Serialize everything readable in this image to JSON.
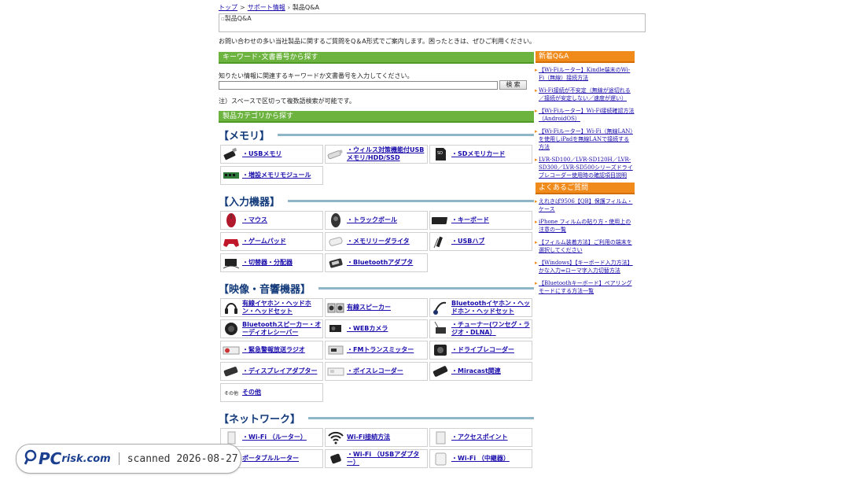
{
  "breadcrumb": {
    "home": "トップ",
    "support": "サポート情報",
    "current": "製品Q&A",
    "sep": ">"
  },
  "banner_alt": "製品Q&A",
  "intro": "お問い合わせの多い当社製品に関するご質問をQ＆A形式でご案内します。困ったときは、ぜひご利用ください。",
  "keyword": {
    "heading": "キーワード･文書番号から探す",
    "desc": "知りたい情報に関連するキーワードか文書番号を入力してください。",
    "input_value": "",
    "button": "検 索",
    "note": "注）スペースで区切って複数語検索が可能です。"
  },
  "category_heading": "製品カテゴリから探す",
  "categories": [
    {
      "title": "【メモリ】",
      "items": [
        {
          "label": "・USBメモリ",
          "icon": "usb-stick-icon"
        },
        {
          "label": "・ウィルス対策機能付USBメモリ/HDD/SSD",
          "icon": "security-usb-icon"
        },
        {
          "label": "・SDメモリカード",
          "icon": "sd-card-icon"
        },
        {
          "label": "・増設メモリモジュール",
          "icon": "memory-module-icon"
        }
      ]
    },
    {
      "title": "【入力機器】",
      "items": [
        {
          "label": "・マウス",
          "icon": "mouse-icon"
        },
        {
          "label": "・トラックボール",
          "icon": "trackball-icon"
        },
        {
          "label": "・キーボード",
          "icon": "keyboard-icon"
        },
        {
          "label": "・ゲームパッド",
          "icon": "gamepad-icon"
        },
        {
          "label": "・メモリリーダライタ",
          "icon": "card-reader-icon"
        },
        {
          "label": "・USBハブ",
          "icon": "usb-hub-icon"
        },
        {
          "label": "・切替器・分配器",
          "icon": "switcher-icon"
        },
        {
          "label": "・Bluetoothアダプタ",
          "icon": "bluetooth-adapter-icon"
        }
      ]
    },
    {
      "title": "【映像・音響機器】",
      "items": [
        {
          "label": "有線イヤホン・ヘッドホン・ヘッドセット",
          "icon": "headphones-icon"
        },
        {
          "label": "有線スピーカー",
          "icon": "speaker-icon"
        },
        {
          "label": "Bluetoothイヤホン・ヘッドホン・ヘッドセット",
          "icon": "bluetooth-headset-icon"
        },
        {
          "label": "Bluetoothスピーカー・オーディオレシーバー",
          "icon": "bluetooth-speaker-icon"
        },
        {
          "label": "・WEBカメラ",
          "icon": "webcam-icon"
        },
        {
          "label": "・チューナー(ワンセグ・ラジオ・DLNA）",
          "icon": "tuner-icon"
        },
        {
          "label": "・緊急警報放送ラジオ",
          "icon": "radio-icon"
        },
        {
          "label": "・FMトランスミッター",
          "icon": "fm-transmitter-icon"
        },
        {
          "label": "・ドライブレコーダー",
          "icon": "dashcam-icon"
        },
        {
          "label": "・ディスプレイアダプター",
          "icon": "display-adapter-icon"
        },
        {
          "label": "・ボイスレコーダー",
          "icon": "voice-recorder-icon"
        },
        {
          "label": "・Miracast関連",
          "icon": "miracast-icon"
        },
        {
          "label": "その他",
          "icon": "other-icon",
          "icon_text": "その他"
        }
      ]
    },
    {
      "title": "【ネットワーク】",
      "items": [
        {
          "label": "・Wi-Fi （ルーター）",
          "icon": "router-icon"
        },
        {
          "label": "Wi-Fi接続方法",
          "icon": "wifi-icon"
        },
        {
          "label": "・アクセスポイント",
          "icon": "access-point-icon"
        },
        {
          "label": "ポータブルルーター",
          "icon": "portable-router-icon"
        },
        {
          "label": "・Wi-Fi （USBアダプター）",
          "icon": "usb-wifi-icon"
        },
        {
          "label": "・Wi-Fi （中継器）",
          "icon": "repeater-icon"
        }
      ]
    }
  ],
  "sidebar": {
    "new_heading": "新着Q&A",
    "new_items": [
      "【Wi-Fiルーター】Kindle端末のWi-Fi（無線）接続方法",
      "Wi-Fi接続が不安定（無線が途切れる／接続が安定しない／速度が遅い）",
      "【Wi-Fiルーター】Wi-Fi接続確認方法（AndroidOS）",
      "【Wi-Fiルーター】Wi-Fi（無線LAN）を使用しiPadを無線LANで接続する方法",
      "LVR-SD100／LVR-SD120H／LVR-SD300／LVR-SD500シリーズドライブレコーダー使用時の確認項目説明"
    ],
    "faq_heading": "よくあるご質問",
    "faq_items": [
      "えれきぱ9506【QB】保護フィルム・ケース",
      "iPhone フィルムの貼り方・使用上の注意の一覧",
      "【フィルム装着方法】ご利用の端末を選択してください",
      "【Windows】【キーボード入力方法】かな入力⇔ローマ字入力切替方法",
      "【Bluetoothキーボード】ペアリングモードにする方法一覧"
    ]
  },
  "watermark": {
    "brand_pc": "PC",
    "brand_risk": "risk.com",
    "scanned": "scanned 2026-08-27"
  },
  "colors": {
    "green": "#6db33f",
    "orange": "#f08a1a",
    "heading_blue": "#123a7a"
  }
}
